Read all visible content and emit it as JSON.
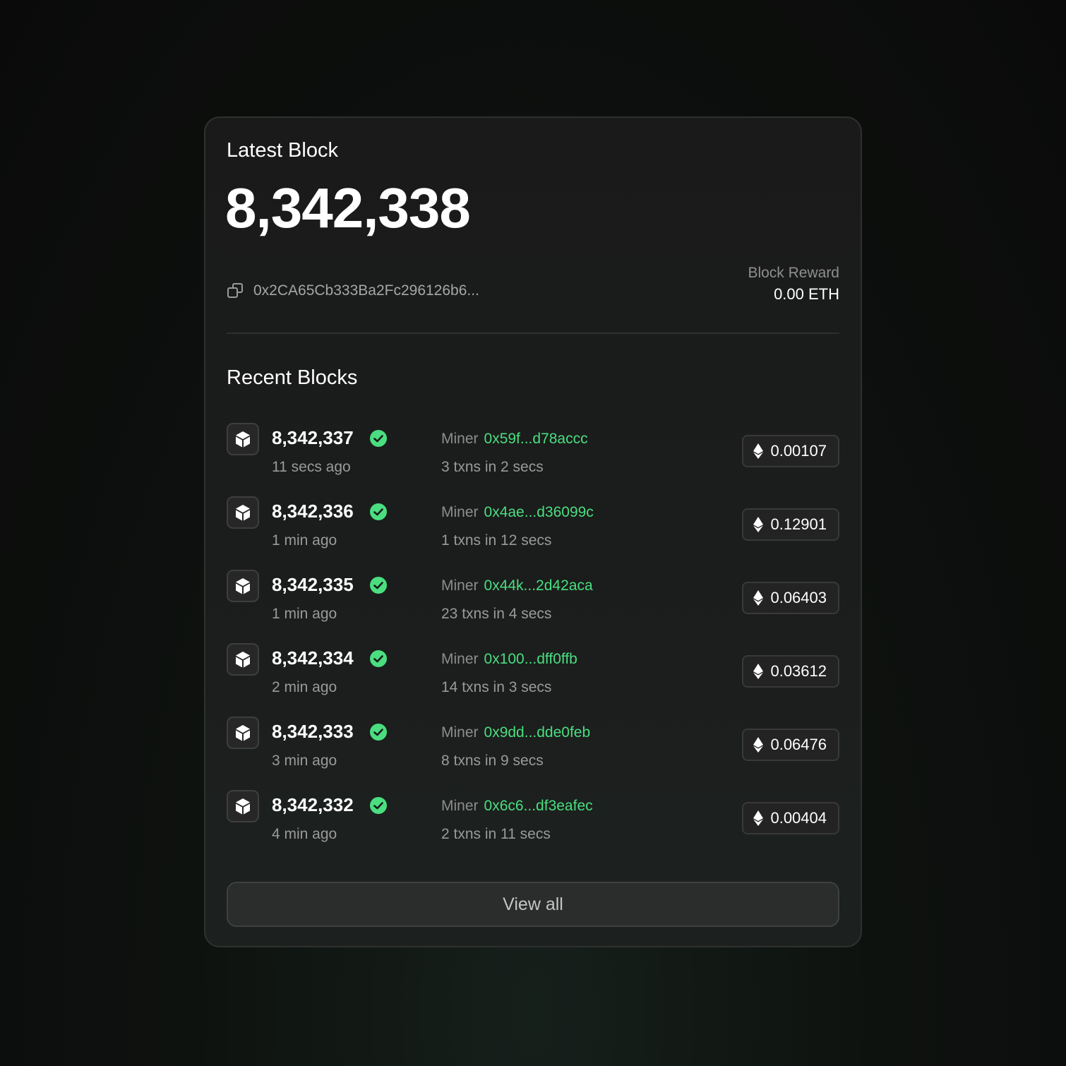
{
  "latest_block": {
    "title": "Latest Block",
    "number": "8,342,338",
    "hash": "0x2CA65Cb333Ba2Fc296126b6...",
    "reward_label": "Block Reward",
    "reward_value": "0.00 ETH",
    "copy_icon": "copy-icon"
  },
  "recent_blocks": {
    "title": "Recent Blocks",
    "miner_label": "Miner",
    "block_icon": "cube-icon",
    "status_icon": "check-circle-icon",
    "value_icon": "ethereum-icon",
    "items": [
      {
        "number": "8,342,337",
        "time": "11 secs ago",
        "miner": "0x59f...d78accc",
        "txns": "3 txns in 2 secs",
        "value": "0.00107"
      },
      {
        "number": "8,342,336",
        "time": "1 min ago",
        "miner": "0x4ae...d36099c",
        "txns": "1 txns in 12 secs",
        "value": "0.12901"
      },
      {
        "number": "8,342,335",
        "time": "1 min ago",
        "miner": "0x44k...2d42aca",
        "txns": "23 txns in 4 secs",
        "value": "0.06403"
      },
      {
        "number": "8,342,334",
        "time": "2 min ago",
        "miner": "0x100...dff0ffb",
        "txns": "14 txns in 3 secs",
        "value": "0.03612"
      },
      {
        "number": "8,342,333",
        "time": "3 min ago",
        "miner": "0x9dd...dde0feb",
        "txns": "8 txns in 9 secs",
        "value": "0.06476"
      },
      {
        "number": "8,342,332",
        "time": "4 min ago",
        "miner": "0x6c6...df3eafec",
        "txns": "2 txns in 11 secs",
        "value": "0.00404"
      }
    ]
  },
  "view_all_label": "View all",
  "colors": {
    "accent_green": "#4ade80",
    "background": "#0a0a0a",
    "card": "#1a1a1a"
  }
}
